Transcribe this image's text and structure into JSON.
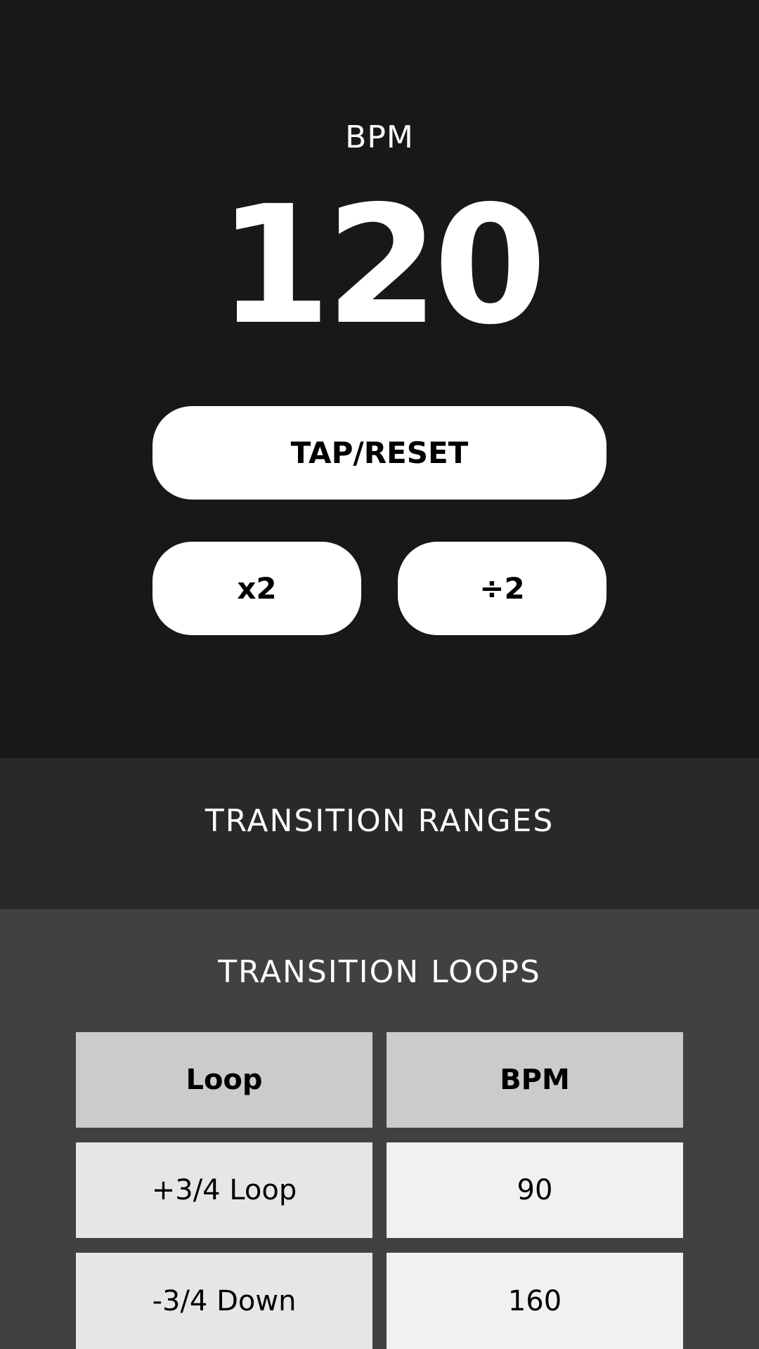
{
  "tempo": {
    "label": "BPM",
    "value": "120"
  },
  "controls": {
    "tap_reset_label": "TAP/RESET",
    "double_label": "x2",
    "half_label": "÷2"
  },
  "ranges": {
    "title": "TRANSITION RANGES"
  },
  "loops": {
    "title": "TRANSITION LOOPS",
    "headers": [
      "Loop",
      "BPM"
    ],
    "rows": [
      {
        "loop": "+3/4 Loop",
        "bpm": "90"
      },
      {
        "loop": "-3/4 Down",
        "bpm": "160"
      }
    ]
  },
  "colors": {
    "top_background": "#181818",
    "ranges_background": "#292929",
    "loops_background": "#414141",
    "button": "#ffffff",
    "table_header": "#cbcbcb",
    "table_cell_left": "#e6e6e6",
    "table_cell_right": "#f1f1f1"
  }
}
